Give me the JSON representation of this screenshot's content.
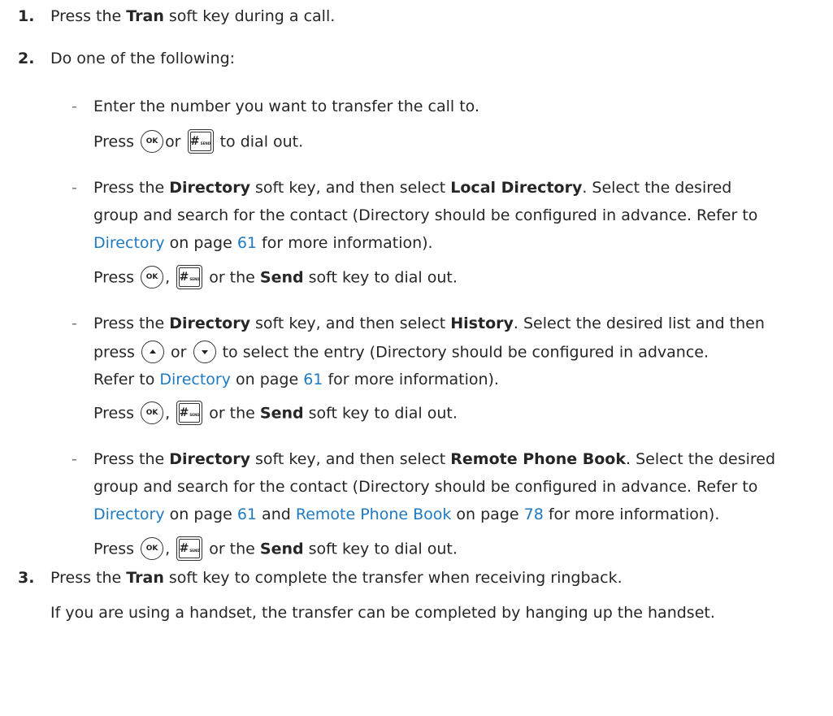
{
  "step1": {
    "num": "1.",
    "pre": "Press the ",
    "key": "Tran",
    "post": " soft key during a call."
  },
  "step2": {
    "num": "2.",
    "text": "Do one of the following:"
  },
  "dash": "-",
  "optA": {
    "line1": "Enter the number you want to transfer the call to.",
    "press": "Press",
    "or": "or",
    "dial": "to dial out."
  },
  "optB": {
    "pre": "Press the ",
    "key1": "Directory",
    "mid": " soft key, and then select ",
    "key2": "Local Directory",
    "post": ". Select the desired",
    "line2": "group and search for the contact (Directory should be configured in advance. Refer to",
    "link": "Directory",
    "onpage": " on page ",
    "page": "61",
    "tail": " for more information).",
    "press": "Press",
    "comma": ",",
    "orthe": " or the ",
    "send": "Send",
    "dial": " soft key to dial out."
  },
  "optC": {
    "pre": "Press the ",
    "key1": "Directory",
    "mid": " soft key, and then select ",
    "key2": "History",
    "post": ". Select the desired list and then",
    "press_l": "press",
    "or": "or",
    "line2_tail": "to select the entry (Directory should be configured in advance.",
    "refer": "Refer to ",
    "link": "Directory",
    "onpage": " on page ",
    "page": "61",
    "tail": " for more information).",
    "press": "Press",
    "comma": ",",
    "orthe": " or the ",
    "send": "Send",
    "dial": " soft key to dial out."
  },
  "optD": {
    "pre": "Press the ",
    "key1": "Directory",
    "mid": " soft key, and then select ",
    "key2": "Remote Phone Book",
    "post": ". Select the desired",
    "line2": "group and search for the contact (Directory should be configured in advance. Refer to",
    "link1": "Directory",
    "onpage1": " on page ",
    "page1": "61",
    "and": " and ",
    "link2": "Remote Phone Book",
    "onpage2": " on page ",
    "page2": "78",
    "tail": " for more information).",
    "press": "Press",
    "comma": ",",
    "orthe": " or the ",
    "send": "Send",
    "dial": " soft key to dial out."
  },
  "step3": {
    "num": "3.",
    "pre": "Press the ",
    "key": "Tran",
    "post": " soft key to complete the transfer when receiving ringback."
  },
  "note": "If you are using a handset, the transfer can be completed by hanging up the handset.",
  "keys": {
    "ok": "OK",
    "hash": "#",
    "send_small": "SEND"
  },
  "colors": {
    "link": "#1f7ac1",
    "text": "#262626"
  }
}
